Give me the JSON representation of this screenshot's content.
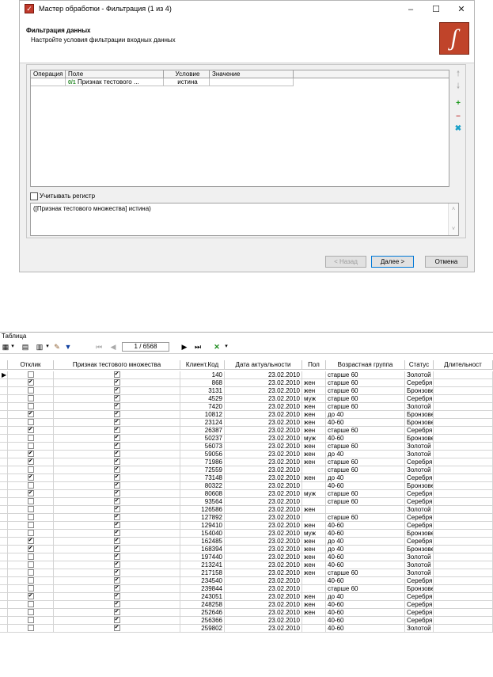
{
  "wizard": {
    "title": "Мастер обработки - Фильтрация (1 из 4)",
    "header_title": "Фильтрация данных",
    "header_subtitle": "Настройте условия фильтрации входных данных",
    "grid_headers": [
      "Операция",
      "Поле",
      "Условие",
      "Значение"
    ],
    "grid_row": {
      "operation": "",
      "field": "Признак тестового ...",
      "condition": "истина",
      "value": ""
    },
    "case_label": "Учитывать регистр",
    "expression": "([Признак тестового множества] истина)",
    "buttons": {
      "back": "< Назад",
      "next": "Далее >",
      "cancel": "Отмена"
    },
    "window_controls": {
      "minimize": "–",
      "maximize": "☐",
      "close": "✕"
    }
  },
  "table": {
    "title": "Таблица",
    "nav_position": "1 / 6568",
    "headers": [
      "Отклик",
      "Признак тестового множества",
      "Клиент.Код",
      "Дата актуальности",
      "Пол",
      "Возрастная группа",
      "Статус",
      "Длительност"
    ],
    "rows": [
      {
        "otklik": false,
        "test": true,
        "code": "140",
        "date": "23.02.2010",
        "sex": "",
        "age": "старше 60",
        "status": "Золотой",
        "current": true
      },
      {
        "otklik": true,
        "test": true,
        "code": "868",
        "date": "23.02.2010",
        "sex": "жен",
        "age": "старше 60",
        "status": "Серебря"
      },
      {
        "otklik": false,
        "test": true,
        "code": "3131",
        "date": "23.02.2010",
        "sex": "жен",
        "age": "старше 60",
        "status": "Бронзове"
      },
      {
        "otklik": false,
        "test": true,
        "code": "4529",
        "date": "23.02.2010",
        "sex": "муж",
        "age": "старше 60",
        "status": "Серебря"
      },
      {
        "otklik": false,
        "test": true,
        "code": "7420",
        "date": "23.02.2010",
        "sex": "жен",
        "age": "старше 60",
        "status": "Золотой"
      },
      {
        "otklik": true,
        "test": true,
        "code": "10812",
        "date": "23.02.2010",
        "sex": "жен",
        "age": "до 40",
        "status": "Бронзове"
      },
      {
        "otklik": false,
        "test": true,
        "code": "23124",
        "date": "23.02.2010",
        "sex": "жен",
        "age": "40-60",
        "status": "Бронзове"
      },
      {
        "otklik": true,
        "test": true,
        "code": "26387",
        "date": "23.02.2010",
        "sex": "жен",
        "age": "старше 60",
        "status": "Серебря"
      },
      {
        "otklik": false,
        "test": true,
        "code": "50237",
        "date": "23.02.2010",
        "sex": "муж",
        "age": "40-60",
        "status": "Бронзове"
      },
      {
        "otklik": false,
        "test": true,
        "code": "56073",
        "date": "23.02.2010",
        "sex": "жен",
        "age": "старше 60",
        "status": "Золотой"
      },
      {
        "otklik": true,
        "test": true,
        "code": "59056",
        "date": "23.02.2010",
        "sex": "жен",
        "age": "до 40",
        "status": "Золотой"
      },
      {
        "otklik": true,
        "test": true,
        "code": "71986",
        "date": "23.02.2010",
        "sex": "жен",
        "age": "старше 60",
        "status": "Серебря"
      },
      {
        "otklik": false,
        "test": true,
        "code": "72559",
        "date": "23.02.2010",
        "sex": "",
        "age": "старше 60",
        "status": "Золотой"
      },
      {
        "otklik": true,
        "test": true,
        "code": "73148",
        "date": "23.02.2010",
        "sex": "жен",
        "age": "до 40",
        "status": "Серебря"
      },
      {
        "otklik": false,
        "test": true,
        "code": "80322",
        "date": "23.02.2010",
        "sex": "",
        "age": "40-60",
        "status": "Бронзове"
      },
      {
        "otklik": true,
        "test": true,
        "code": "80608",
        "date": "23.02.2010",
        "sex": "муж",
        "age": "старше 60",
        "status": "Серебря"
      },
      {
        "otklik": false,
        "test": true,
        "code": "93564",
        "date": "23.02.2010",
        "sex": "",
        "age": "старше 60",
        "status": "Серебря"
      },
      {
        "otklik": false,
        "test": true,
        "code": "126586",
        "date": "23.02.2010",
        "sex": "жен",
        "age": "",
        "status": "Золотой"
      },
      {
        "otklik": false,
        "test": true,
        "code": "127892",
        "date": "23.02.2010",
        "sex": "",
        "age": "старше 60",
        "status": "Серебря"
      },
      {
        "otklik": false,
        "test": true,
        "code": "129410",
        "date": "23.02.2010",
        "sex": "жен",
        "age": "40-60",
        "status": "Серебря"
      },
      {
        "otklik": false,
        "test": true,
        "code": "154040",
        "date": "23.02.2010",
        "sex": "муж",
        "age": "40-60",
        "status": "Бронзове"
      },
      {
        "otklik": true,
        "test": true,
        "code": "162485",
        "date": "23.02.2010",
        "sex": "жен",
        "age": "до 40",
        "status": "Серебря"
      },
      {
        "otklik": true,
        "test": true,
        "code": "168394",
        "date": "23.02.2010",
        "sex": "жен",
        "age": "до 40",
        "status": "Бронзове"
      },
      {
        "otklik": false,
        "test": true,
        "code": "197440",
        "date": "23.02.2010",
        "sex": "жен",
        "age": "40-60",
        "status": "Золотой"
      },
      {
        "otklik": false,
        "test": true,
        "code": "213241",
        "date": "23.02.2010",
        "sex": "жен",
        "age": "40-60",
        "status": "Золотой"
      },
      {
        "otklik": false,
        "test": true,
        "code": "217158",
        "date": "23.02.2010",
        "sex": "жен",
        "age": "старше 60",
        "status": "Золотой"
      },
      {
        "otklik": false,
        "test": true,
        "code": "234540",
        "date": "23.02.2010",
        "sex": "",
        "age": "40-60",
        "status": "Серебря"
      },
      {
        "otklik": false,
        "test": true,
        "code": "239844",
        "date": "23.02.2010",
        "sex": "",
        "age": "старше 60",
        "status": "Бронзове"
      },
      {
        "otklik": true,
        "test": true,
        "code": "243051",
        "date": "23.02.2010",
        "sex": "жен",
        "age": "до 40",
        "status": "Серебря"
      },
      {
        "otklik": false,
        "test": true,
        "code": "248258",
        "date": "23.02.2010",
        "sex": "жен",
        "age": "40-60",
        "status": "Серебря"
      },
      {
        "otklik": false,
        "test": true,
        "code": "252646",
        "date": "23.02.2010",
        "sex": "жен",
        "age": "40-60",
        "status": "Серебря"
      },
      {
        "otklik": false,
        "test": true,
        "code": "256366",
        "date": "23.02.2010",
        "sex": "",
        "age": "40-60",
        "status": "Серебря"
      },
      {
        "otklik": false,
        "test": true,
        "code": "259802",
        "date": "23.02.2010",
        "sex": "",
        "age": "40-60",
        "status": "Золотой"
      }
    ]
  },
  "icons": {
    "check": "✔",
    "current_row": "▶"
  }
}
